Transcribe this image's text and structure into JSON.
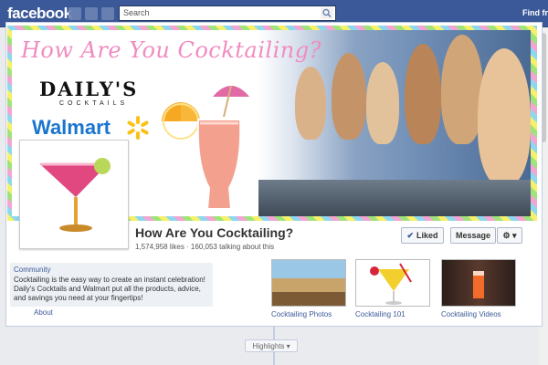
{
  "topbar": {
    "logo": "facebook",
    "search_placeholder": "Search",
    "find_friends": "Find fri"
  },
  "cover": {
    "headline_part1": "How Are You ",
    "headline_part2": "Cocktailing?",
    "brand1": "DAILY'S",
    "brand1_sub": "COCKTAILS",
    "brand2": "Walmart"
  },
  "page": {
    "name": "How Are You Cocktailing?",
    "stats": "1,574,958 likes · 160,053 talking about this",
    "liked_label": "Liked",
    "message_label": "Message",
    "gear_label": "⚙ ▾"
  },
  "info": {
    "category": "Community",
    "description": "Cocktailing is the easy way to create an instant celebration! Daily's Cocktails and Walmart put all the products, advice, and savings you need at your fingertips!",
    "about_link": "About"
  },
  "apps": [
    {
      "label": "Cocktailing Photos"
    },
    {
      "label": "Cocktailing 101"
    },
    {
      "label": "Cocktailing Videos"
    }
  ],
  "timeline": {
    "highlights_label": "Highlights"
  },
  "colors": {
    "brand_blue": "#3b5998",
    "link_blue": "#3b5998",
    "walmart_blue": "#1a75cf",
    "walmart_spark": "#f9c21b",
    "cocktail_pink": "#e0487f"
  }
}
